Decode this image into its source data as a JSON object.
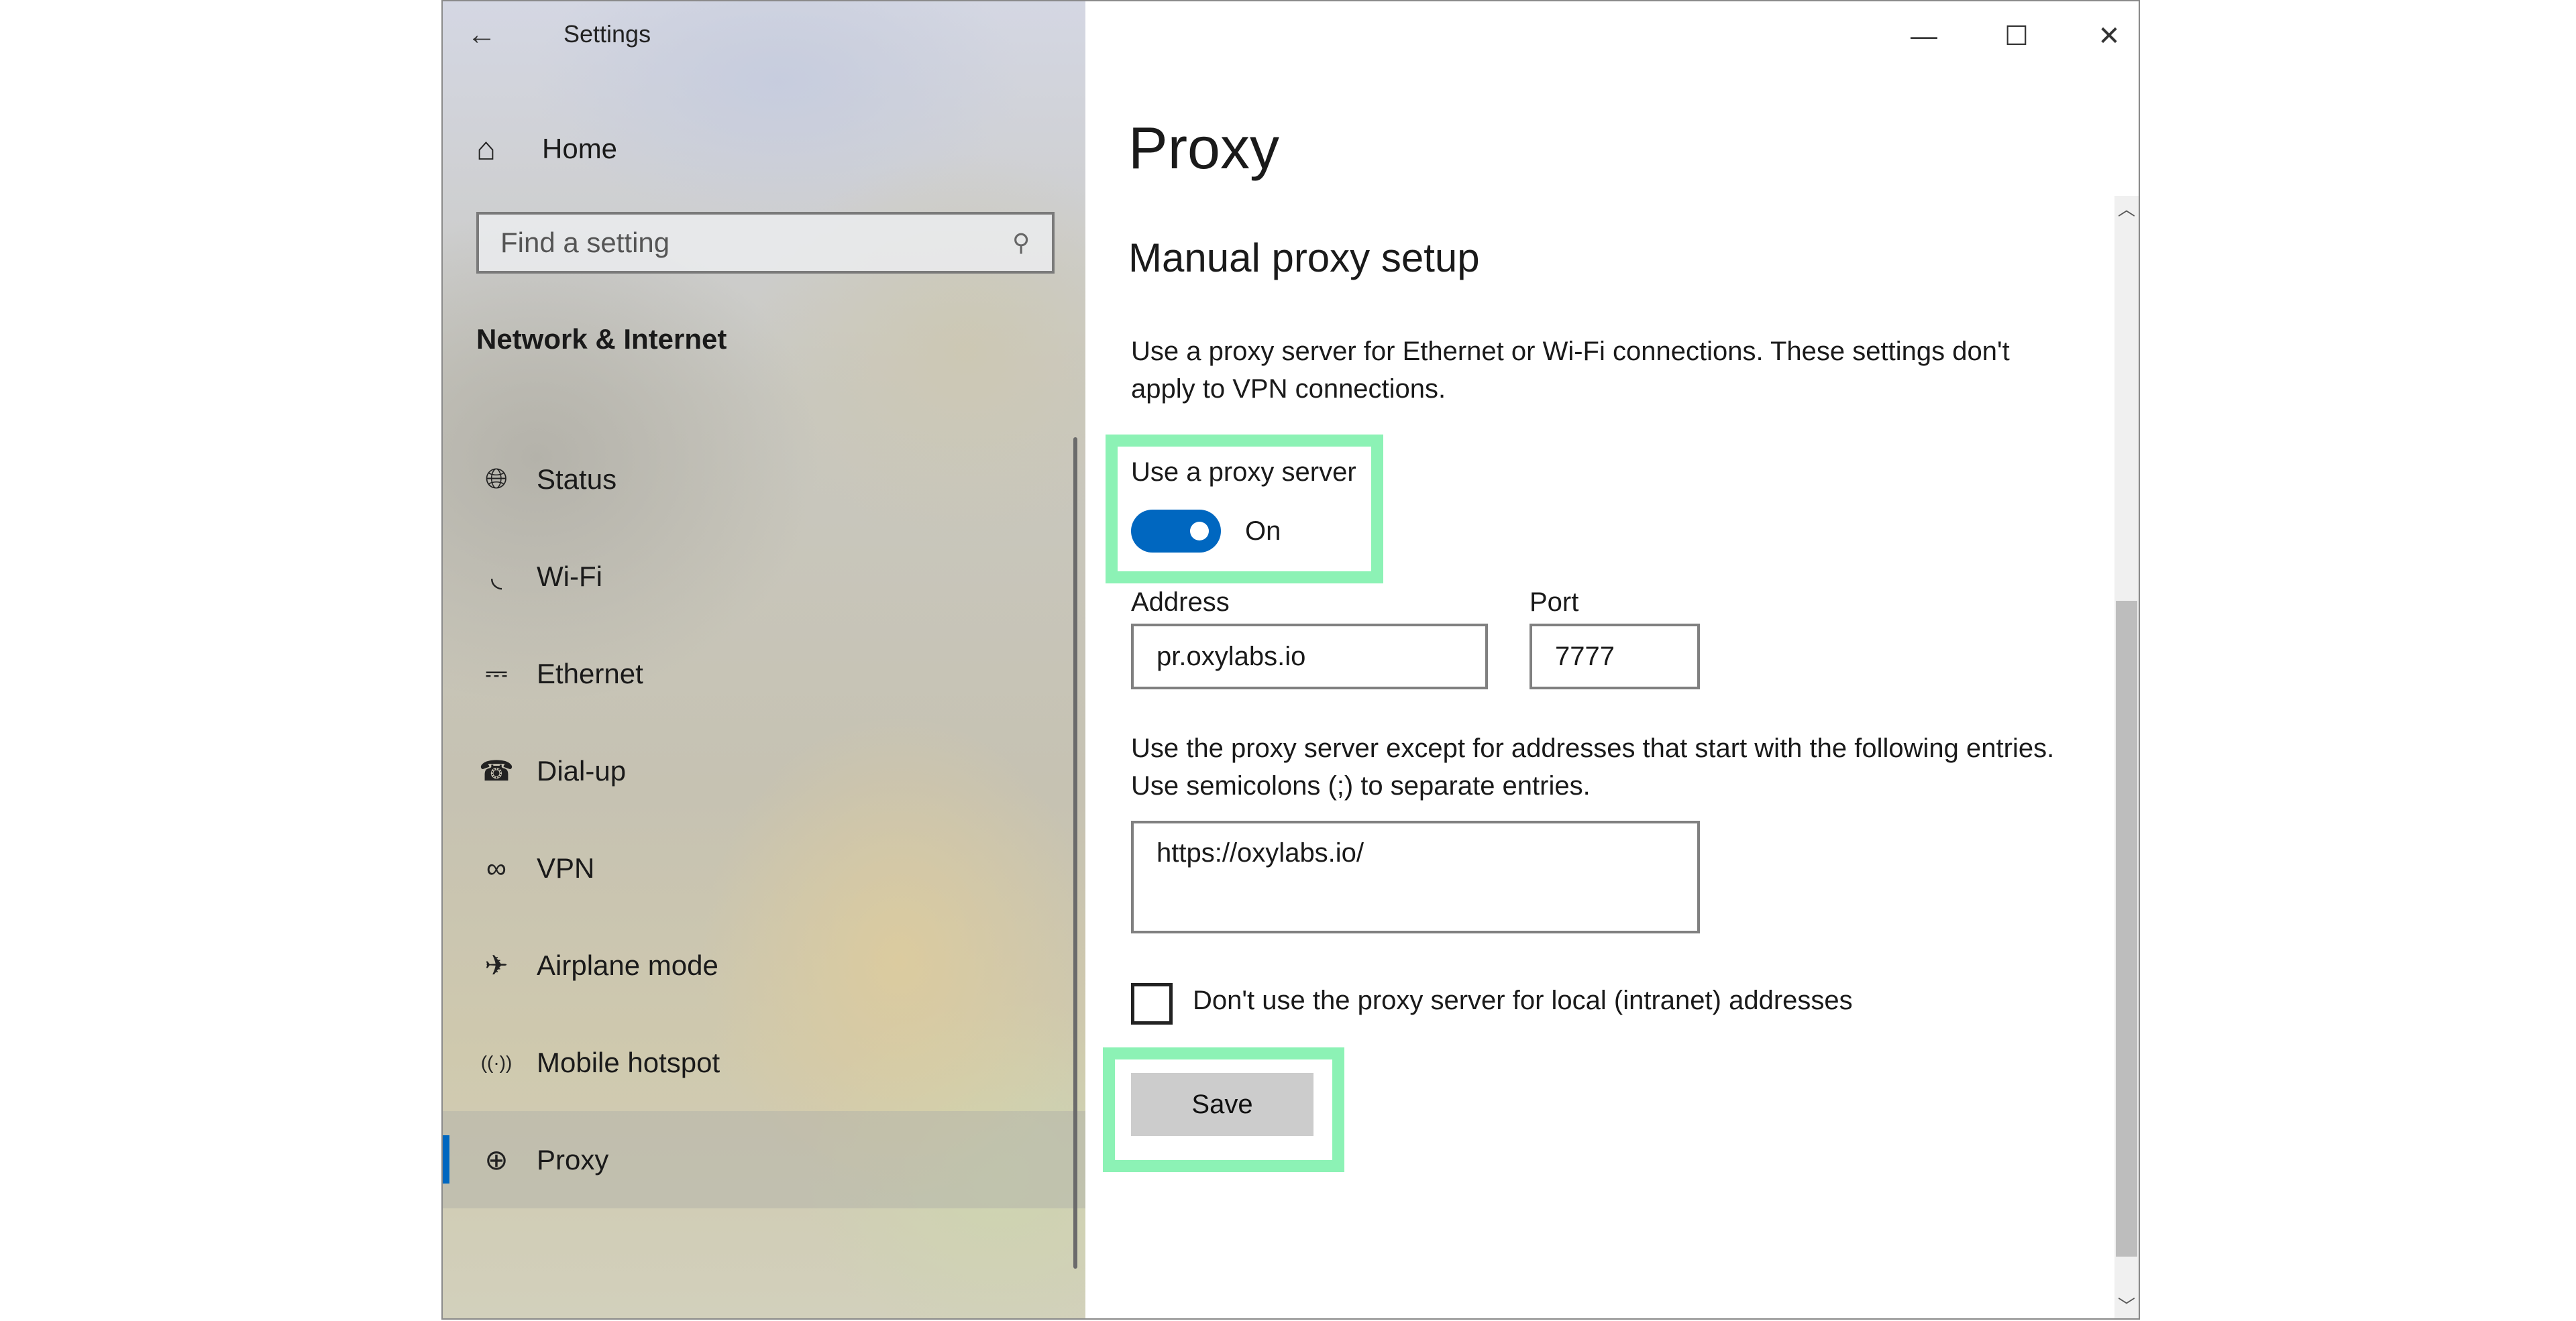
{
  "window": {
    "title": "Settings",
    "back_icon": "←",
    "minimize_icon": "—",
    "maximize_icon": "☐",
    "close_icon": "✕"
  },
  "sidebar": {
    "home": {
      "label": "Home",
      "icon": "⌂"
    },
    "search": {
      "placeholder": "Find a setting",
      "icon": "⚲"
    },
    "section_title": "Network & Internet",
    "items": [
      {
        "label": "Status",
        "icon": "globe-monitor",
        "glyph": "🌐︎",
        "active": false
      },
      {
        "label": "Wi-Fi",
        "icon": "wifi",
        "glyph": "◟",
        "active": false
      },
      {
        "label": "Ethernet",
        "icon": "ethernet",
        "glyph": "⎓",
        "active": false
      },
      {
        "label": "Dial-up",
        "icon": "dialup",
        "glyph": "☎",
        "active": false
      },
      {
        "label": "VPN",
        "icon": "vpn",
        "glyph": "∞",
        "active": false
      },
      {
        "label": "Airplane mode",
        "icon": "airplane",
        "glyph": "✈",
        "active": false
      },
      {
        "label": "Mobile hotspot",
        "icon": "hotspot",
        "glyph": "((·))",
        "active": false
      },
      {
        "label": "Proxy",
        "icon": "globe",
        "glyph": "⊕",
        "active": true
      }
    ]
  },
  "main": {
    "title": "Proxy",
    "section_title": "Manual proxy setup",
    "description": "Use a proxy server for Ethernet or Wi-Fi connections. These settings don't apply to VPN connections.",
    "use_proxy": {
      "label": "Use a proxy server",
      "state": "On",
      "enabled": true
    },
    "address": {
      "label": "Address",
      "value": "pr.oxylabs.io"
    },
    "port": {
      "label": "Port",
      "value": "7777"
    },
    "exceptions": {
      "description": "Use the proxy server except for addresses that start with the following entries. Use semicolons (;) to separate entries.",
      "value": "https://oxylabs.io/"
    },
    "local_bypass": {
      "label": "Don't use the proxy server for local (intranet) addresses",
      "checked": false
    },
    "save_label": "Save"
  },
  "colors": {
    "accent": "#0067c0",
    "highlight": "#8cf2b5",
    "button_bg": "#cccccc"
  }
}
